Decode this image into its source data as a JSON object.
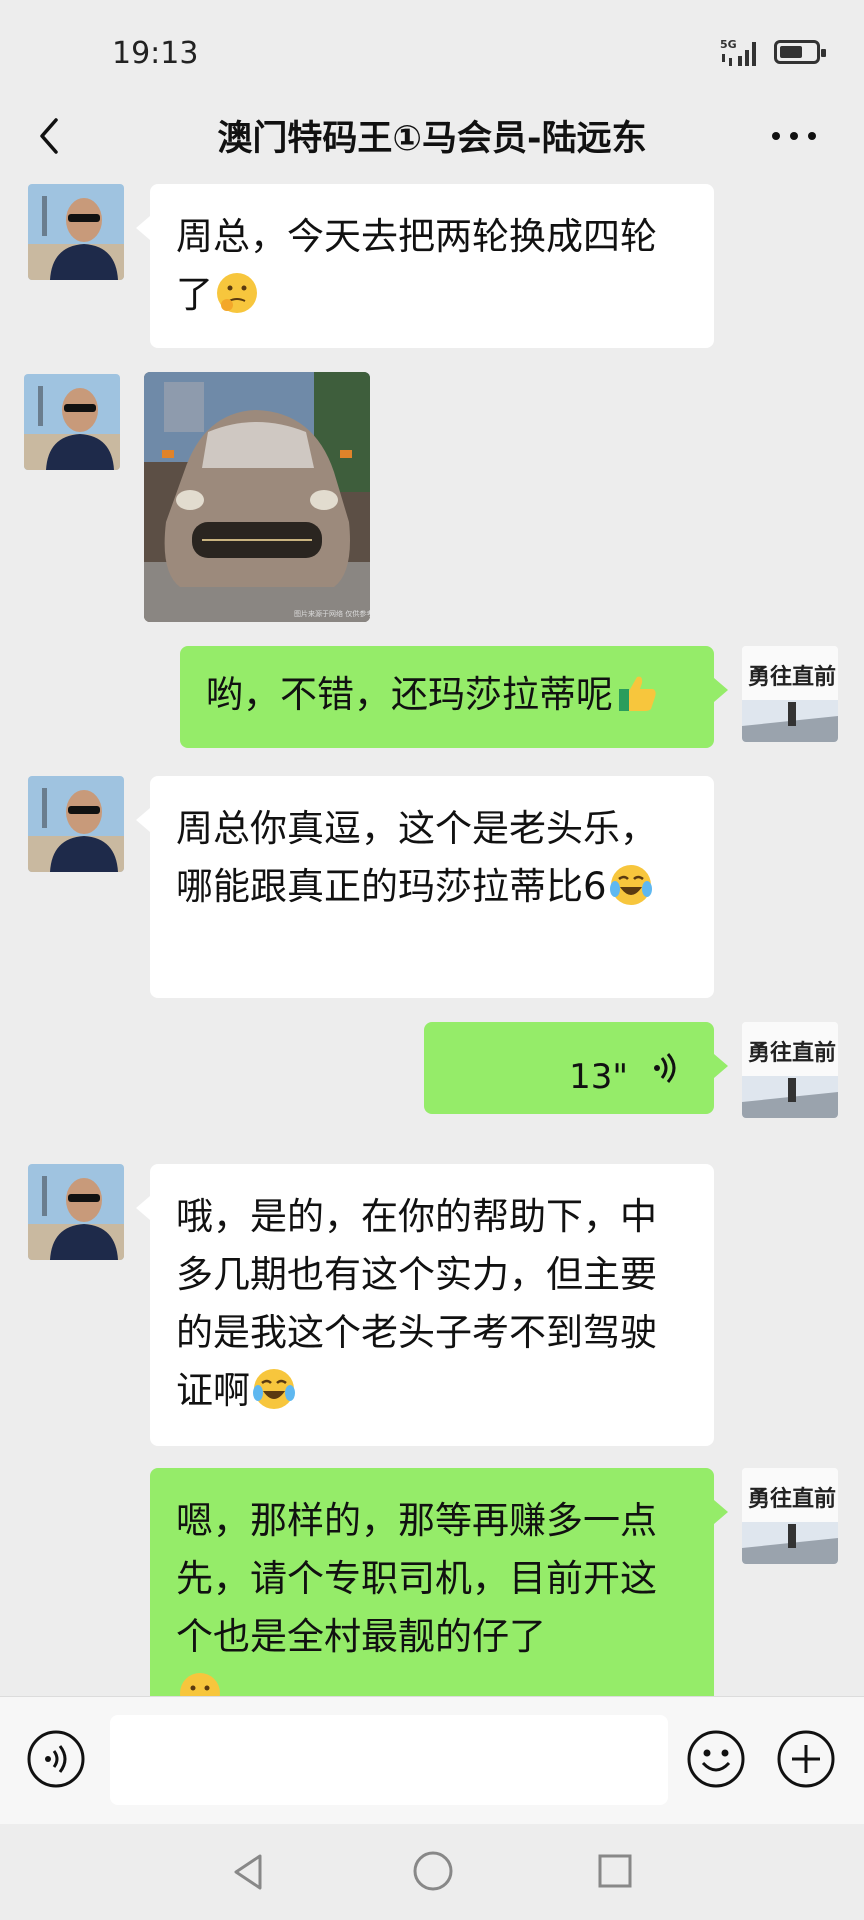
{
  "status": {
    "time": "19:13",
    "network": "5G"
  },
  "header": {
    "title": "澳门特码王①马会员-陆远东"
  },
  "messages": [
    {
      "side": "left",
      "type": "text",
      "text": "周总，今天去把两轮换成四轮了",
      "emoji": "thinking-face-emoji"
    },
    {
      "side": "left",
      "type": "image",
      "watermark": "图片来源于网络 仅供参考"
    },
    {
      "side": "right",
      "type": "text",
      "text": "哟，不错，还玛莎拉蒂呢",
      "emoji": "thumbs-up-emoji"
    },
    {
      "side": "left",
      "type": "text",
      "text": "周总你真逗，这个是老头乐，哪能跟真正的玛莎拉蒂比6",
      "emoji": "tears-of-joy-emoji"
    },
    {
      "side": "right",
      "type": "voice",
      "duration": "13\""
    },
    {
      "side": "left",
      "type": "text",
      "text": "哦，是的，在你的帮助下，中多几期也有这个实力，但主要的是我这个老头子考不到驾驶证啊",
      "emoji": "tears-of-joy-emoji"
    },
    {
      "side": "right",
      "type": "text",
      "text": "嗯，那样的，那等再赚多一点先，请个专职司机，目前开这个也是全村最靓的仔了",
      "emoji": "grinning-face-emoji"
    }
  ],
  "avatar_right_text": "勇往直前",
  "colors": {
    "background": "#ededed",
    "incoming_bubble": "#ffffff",
    "outgoing_bubble": "#95ec69"
  }
}
